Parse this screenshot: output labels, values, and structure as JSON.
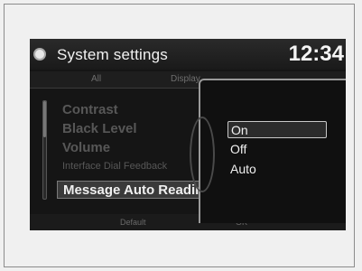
{
  "header": {
    "title": "System settings",
    "clock": "12:34"
  },
  "tabs": [
    {
      "label": "All"
    },
    {
      "label": "Display"
    }
  ],
  "menu": {
    "items": [
      {
        "label": "Contrast"
      },
      {
        "label": "Black Level"
      },
      {
        "label": "Volume"
      },
      {
        "label": "Interface Dial Feedback"
      },
      {
        "label": "Message Auto Reading"
      }
    ],
    "selected_index": 4
  },
  "popup": {
    "options": [
      {
        "label": "On"
      },
      {
        "label": "Off"
      },
      {
        "label": "Auto"
      }
    ],
    "highlighted_index": 0
  },
  "bottom_bar": {
    "default_label": "Default",
    "ok_label": "OK"
  }
}
